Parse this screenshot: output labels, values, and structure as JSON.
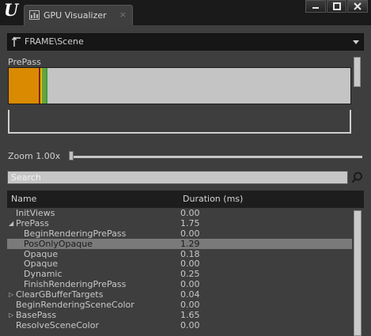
{
  "window": {
    "tab_title": "GPU Visualizer",
    "tab_close": "×",
    "minimize": "▬",
    "maximize": "□",
    "close": "✕"
  },
  "breadcrumb": {
    "label": "FRAME\\Scene",
    "up_icon": "up-arrow-icon",
    "dropdown_icon": "chevron-down-icon"
  },
  "timeline": {
    "pass_label": "PrePass",
    "segments": [
      {
        "color": "#d98a00",
        "fraction": 0.088
      },
      {
        "color": "#8b1a1a",
        "fraction": 0.005
      },
      {
        "color": "#d4c100",
        "fraction": 0.005
      },
      {
        "color": "#6aa33a",
        "fraction": 0.012
      },
      {
        "color": "#3f9a3f",
        "fraction": 0.004
      }
    ],
    "background_color": "#c4c4c4"
  },
  "zoom": {
    "label": "Zoom 1.00x",
    "value": 1.0
  },
  "search": {
    "placeholder": "Search",
    "icon": "search-icon"
  },
  "table": {
    "columns": {
      "name": "Name",
      "duration": "Duration (ms)"
    },
    "rows": [
      {
        "name": "InitViews",
        "value": "0.00",
        "depth": 0,
        "expander": "",
        "selected": false
      },
      {
        "name": "PrePass",
        "value": "1.75",
        "depth": 0,
        "expander": "◢",
        "selected": false
      },
      {
        "name": "BeginRenderingPrePass",
        "value": "0.00",
        "depth": 1,
        "expander": "",
        "selected": false
      },
      {
        "name": "PosOnlyOpaque",
        "value": "1.29",
        "depth": 1,
        "expander": "",
        "selected": true
      },
      {
        "name": "Opaque",
        "value": "0.18",
        "depth": 1,
        "expander": "",
        "selected": false
      },
      {
        "name": "Opaque",
        "value": "0.00",
        "depth": 1,
        "expander": "",
        "selected": false
      },
      {
        "name": "Dynamic",
        "value": "0.25",
        "depth": 1,
        "expander": "",
        "selected": false
      },
      {
        "name": "FinishRenderingPrePass",
        "value": "0.00",
        "depth": 1,
        "expander": "",
        "selected": false
      },
      {
        "name": "ClearGBufferTargets",
        "value": "0.04",
        "depth": 0,
        "expander": "▷",
        "selected": false
      },
      {
        "name": "BeginRenderingSceneColor",
        "value": "0.00",
        "depth": 0,
        "expander": "",
        "selected": false
      },
      {
        "name": "BasePass",
        "value": "1.65",
        "depth": 0,
        "expander": "▷",
        "selected": false
      },
      {
        "name": "ResolveSceneColor",
        "value": "0.00",
        "depth": 0,
        "expander": "",
        "selected": false
      }
    ]
  }
}
